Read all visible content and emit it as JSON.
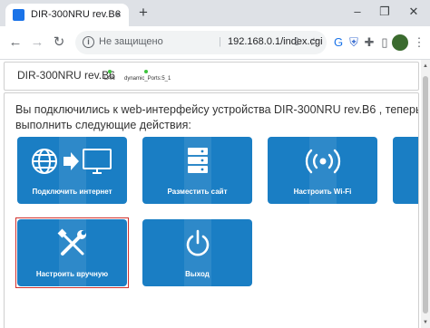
{
  "browser": {
    "tab_title": "DIR-300NRU rev.B6",
    "tab_close": "×",
    "new_tab": "+",
    "window_controls": {
      "minimize": "–",
      "restore": "❐",
      "close": "✕"
    },
    "nav": {
      "back": "←",
      "forward": "→",
      "reload": "↻"
    },
    "security_label": "Не защищено",
    "separator": "|",
    "url": "192.168.0.1/index.cgi",
    "icons": [
      "info-icon",
      "share-icon",
      "bookmark-star-icon",
      "translate-icon",
      "security-shield-icon",
      "extensions-puzzle-icon",
      "side-panel-icon",
      "profile-avatar",
      "menu-kebab-icon"
    ]
  },
  "router": {
    "device_name": "DIR-300NRU rev.B6",
    "status": [
      {
        "label": "LAN",
        "color": "#3ec43e"
      },
      {
        "label": "dynamic_Ports:5_1",
        "color": "#3ec43e"
      }
    ],
    "intro_text": "Вы подключились к web-интерфейсу устройства DIR-300NRU rev.B6 , теперь вы сможете выполнить следующие действия:",
    "tiles": [
      {
        "label": "Подключить интернет",
        "icon": "globe-to-monitor-icon",
        "selected": false
      },
      {
        "label": "Разместить сайт",
        "icon": "server-icon",
        "selected": false
      },
      {
        "label": "Настроить Wi-Fi",
        "icon": "wifi-broadcast-icon",
        "selected": false
      },
      {
        "label": "",
        "icon": "",
        "selected": false
      },
      {
        "label": "Настроить вручную",
        "icon": "wrench-screwdriver-icon",
        "selected": true
      },
      {
        "label": "Выход",
        "icon": "power-icon",
        "selected": false
      }
    ],
    "colors": {
      "tile_blue": "#1a7ec4",
      "selection_red": "#d0312d",
      "status_green": "#3ec43e"
    }
  }
}
